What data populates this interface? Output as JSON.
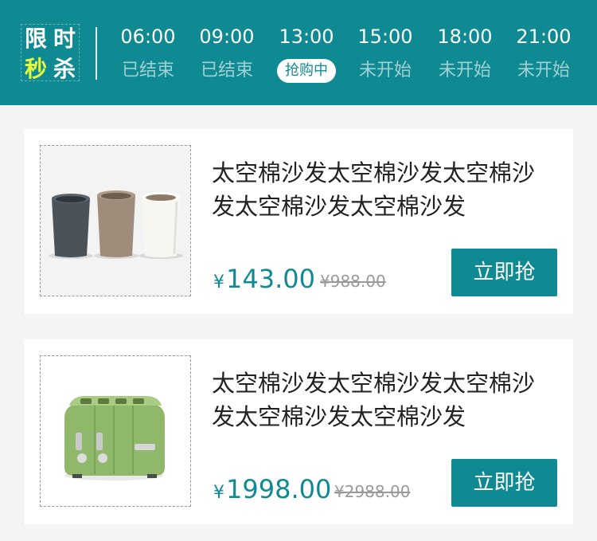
{
  "header": {
    "logo": [
      "限",
      "时",
      "秒",
      "杀"
    ],
    "logo_accent": "#e6ff3a",
    "background": "#0f8a92",
    "slots": [
      {
        "time": "06:00",
        "status": "已结束"
      },
      {
        "time": "09:00",
        "status": "已结束"
      },
      {
        "time": "13:00",
        "status": "抢购中"
      },
      {
        "time": "15:00",
        "status": "未开始"
      },
      {
        "time": "18:00",
        "status": "未开始"
      },
      {
        "time": "21:00",
        "status": "未开始"
      }
    ],
    "active_slot": "13:00"
  },
  "products": [
    {
      "title": "太空棉沙发太空棉沙发太空棉沙发太空棉沙发太空棉沙发",
      "currency": "¥",
      "price": "143.00",
      "original_price": "¥988.00",
      "buy_label": "立即抢",
      "image": "three-cups"
    },
    {
      "title": "太空棉沙发太空棉沙发太空棉沙发太空棉沙发太空棉沙发",
      "currency": "¥",
      "price": "1998.00",
      "original_price": "¥2988.00",
      "buy_label": "立即抢",
      "image": "green-toaster"
    }
  ]
}
